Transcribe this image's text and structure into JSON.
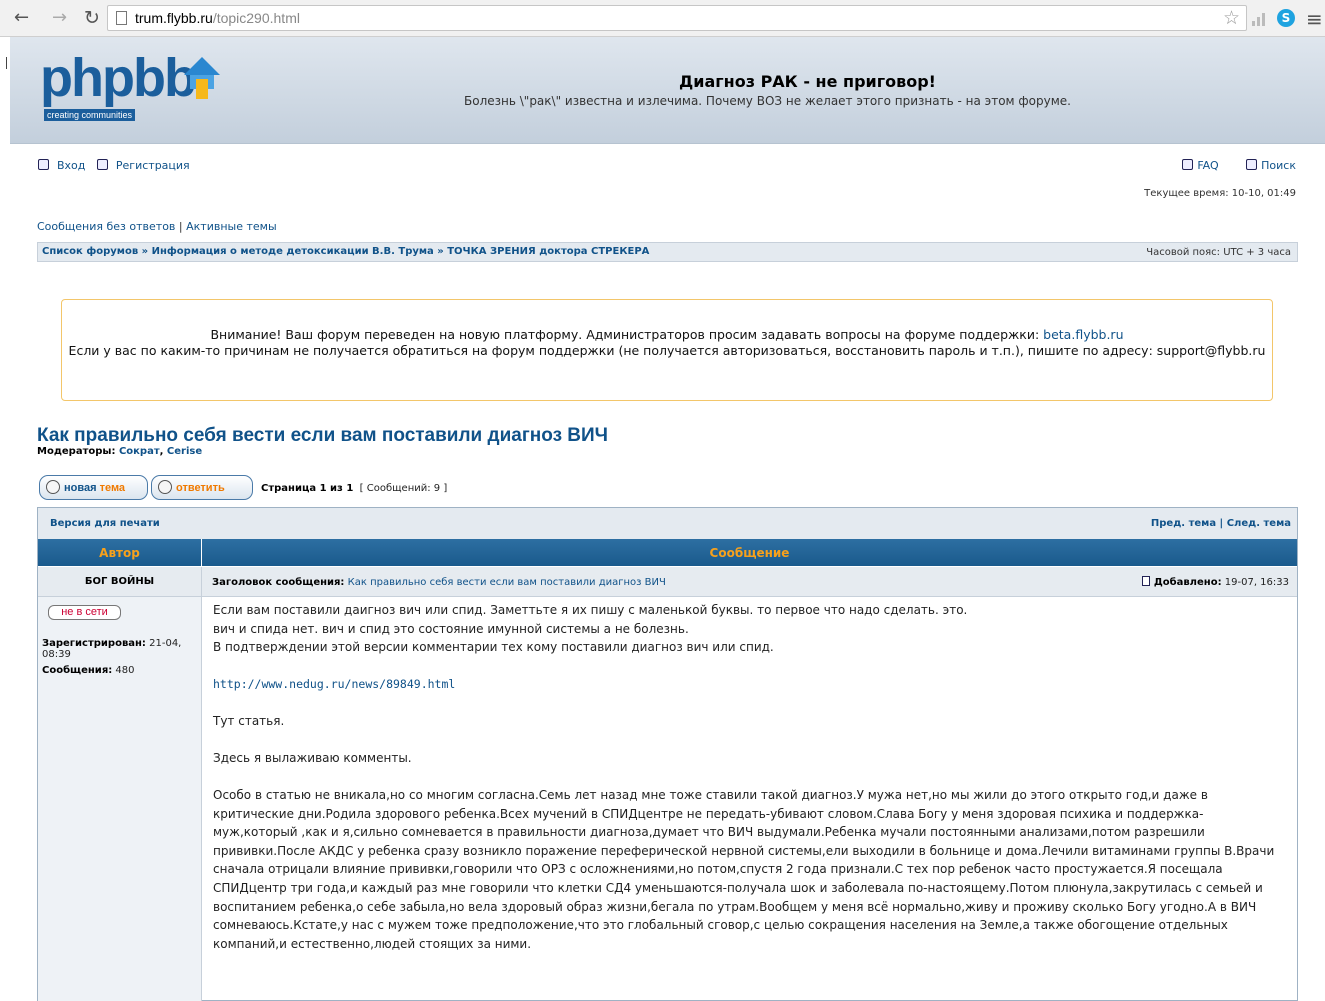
{
  "browser": {
    "url_host": "trum.flybb.ru",
    "url_path": "/topic290.html"
  },
  "header": {
    "logo_tag": "creating communities",
    "logo_text": "phpbb",
    "title": "Диагноз РАК - не приговор!",
    "description": "Болезнь \\\"рак\\\" известна и излечима. Почему ВОЗ не желает этого признать - на этом форуме."
  },
  "nav": {
    "login": "Вход",
    "register": "Регистрация",
    "faq": "FAQ",
    "search": "Поиск",
    "current_time": "Текущее время: 10-10, 01:49",
    "unanswered": "Сообщения без ответов",
    "separator": "|",
    "active": "Активные темы"
  },
  "breadcrumbs": {
    "path": "Список форумов » Информация о методе детоксикации В.В. Трума » ТОЧКА ЗРЕНИЯ доктора СТРЕКЕРА",
    "timezone": "Часовой пояс: UTC + 3 часа"
  },
  "notice": {
    "line1": "Внимание! Ваш форум переведен на новую платформу. Администраторов просим задавать вопросы на форуме поддержки: ",
    "line1_link": "beta.flybb.ru",
    "line2": "Если у вас по каким-то причинам не получается обратиться на форум поддержки (не получается авторизоваться, восстановить пароль и т.п.), пишите по адресу: support@flybb.ru"
  },
  "topic": {
    "title": "Как правильно себя вести если вам поставили диагноз ВИЧ",
    "moderators_label": "Модераторы:",
    "moderators": [
      "Сократ",
      "Cerise"
    ],
    "new_topic_a": "новая ",
    "new_topic_b": "тема",
    "reply": "ответить",
    "page": "Страница 1 из 1",
    "count": "[ Сообщений: 9 ]"
  },
  "table": {
    "print": "Версия для печати",
    "prev_next": "Пред. тема | След. тема",
    "col_author": "Автор",
    "col_message": "Сообщение"
  },
  "post": {
    "author": "БОГ ВОЙНЫ",
    "subject_label": "Заголовок сообщения:",
    "subject": "Как правильно себя вести если вам поставили диагноз ВИЧ",
    "posted_label": "Добавлено:",
    "posted": "19-07, 16:33",
    "status": "не в сети",
    "registered_label": "Зарегистрирован:",
    "registered": "21-04, 08:39",
    "posts_label": "Сообщения:",
    "posts": "480",
    "body": {
      "p1": "Если вам поставили даигноз вич или спид. Заметтьте я их пишу с маленькой буквы. то первое что надо сделать. это.",
      "p2": "вич и спида нет. вич и спид это состояние имунной системы а не болезнь.",
      "p3": "В подтверждении этой версии комментарии тех кому поставили диагноз вич или спид.",
      "url": "http://www.nedug.ru/news/89849.html",
      "p4": "Тут статья.",
      "p5": "Здесь я вылаживаю комменты.",
      "p6": "Особо в статью не вникала,но со многим согласна.Семь лет назад мне тоже ставили такой диагноз.У мужа нет,но мы жили до этого открыто год,и даже в критические дни.Родила здорового ребенка.Всех мучений в СПИДцентре не передать-убивают словом.Слава Богу у меня здоровая психика и поддержка-муж,который ,как и я,сильно сомневается в правильности диагноза,думает что ВИЧ выдумали.Ребенка мучали постоянными анализами,потом разрешили прививки.После АКДС у ребенка сразу возникло поражение переферической нервной системы,ели выходили в больнице и дома.Лечили витаминами группы В.Врачи сначала отрицали влияние прививки,говорили что ОРЗ с осложнениями,но потом,спустя 2 года признали.С тех пор ребенок часто простужается.Я посещала СПИДцентр три года,и каждый раз мне говорили что клетки СД4 уменьшаются-получала шок и заболевала по-настоящему.Потом плюнула,закрутилась с семьей и воспитанием ребенка,о себе забыла,но вела здоровый образ жизни,бегала по утрам.Вообщем у меня всё нормально,живу и проживу сколько Богу угодно.А в ВИЧ сомневаюсь.Кстате,у нас с мужем тоже предположение,что это глобальный сговор,с целью сокращения населения на Земле,а также обогощение отдельных компаний,и естественно,людей стоящих за ними."
    }
  }
}
